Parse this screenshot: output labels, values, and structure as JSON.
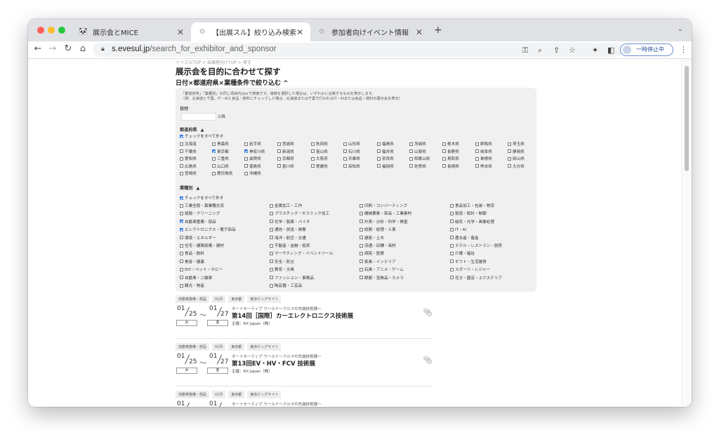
{
  "browser": {
    "tabs": [
      {
        "label": "展示会とMICE",
        "icon": "panda-favicon"
      },
      {
        "label": "【出展スル】絞り込み検索",
        "icon": "gear-favicon"
      },
      {
        "label": "参加者向けイベント情報",
        "icon": "gear-favicon"
      }
    ],
    "new_tab": "+",
    "url_host": "s.evesul.jp",
    "url_path": "/search_for_exhibitor_and_sponsor",
    "profile_label": "一時停止中"
  },
  "page": {
    "breadcrumb": "イベスルTOP > 出展者向けTOP > 探す",
    "title": "展示会を目的に合わせて探す",
    "subtitle": "日付×都道府県×業種条件で絞り込む",
    "subtitle_icon": "^",
    "note1": "「都道府県」「業種別」の同じ項目内はorで検索です。複数を選択した場合は、いずれかに合致するものを表示します。",
    "note2": "（例：北海道と千葉、IT・AIと食品・飲料にチェックした場合…北海道または千葉で行われるIT・AIまたは食品・飲料の展示会を表示）",
    "date_label": "日付",
    "date_suffix": "以降",
    "pref_label": "都道府県",
    "pref_toggle": "▲",
    "pref_uncheck_all": "チェックをすべて外す",
    "industry_label": "業種別",
    "industry_toggle": "▲",
    "industry_uncheck_all": "チェックをすべて外す"
  },
  "prefectures": [
    {
      "name": "北海道",
      "checked": false
    },
    {
      "name": "青森県",
      "checked": false
    },
    {
      "name": "岩手県",
      "checked": false
    },
    {
      "name": "宮城県",
      "checked": false
    },
    {
      "name": "秋田県",
      "checked": false
    },
    {
      "name": "山形県",
      "checked": false
    },
    {
      "name": "福島県",
      "checked": false
    },
    {
      "name": "茨城県",
      "checked": false
    },
    {
      "name": "栃木県",
      "checked": false
    },
    {
      "name": "群馬県",
      "checked": false
    },
    {
      "name": "埼玉県",
      "checked": false
    },
    {
      "name": "千葉県",
      "checked": false
    },
    {
      "name": "東京都",
      "checked": true
    },
    {
      "name": "神奈川県",
      "checked": true
    },
    {
      "name": "新潟県",
      "checked": false
    },
    {
      "name": "富山県",
      "checked": false
    },
    {
      "name": "石川県",
      "checked": false
    },
    {
      "name": "福井県",
      "checked": false
    },
    {
      "name": "山梨県",
      "checked": false
    },
    {
      "name": "長野県",
      "checked": false
    },
    {
      "name": "岐阜県",
      "checked": false
    },
    {
      "name": "静岡県",
      "checked": false
    },
    {
      "name": "愛知県",
      "checked": false
    },
    {
      "name": "三重県",
      "checked": false
    },
    {
      "name": "滋賀県",
      "checked": false
    },
    {
      "name": "京都府",
      "checked": false
    },
    {
      "name": "大阪府",
      "checked": false
    },
    {
      "name": "兵庫県",
      "checked": false
    },
    {
      "name": "奈良県",
      "checked": false
    },
    {
      "name": "和歌山県",
      "checked": false
    },
    {
      "name": "鳥取県",
      "checked": false
    },
    {
      "name": "島根県",
      "checked": false
    },
    {
      "name": "岡山県",
      "checked": false
    },
    {
      "name": "広島県",
      "checked": false
    },
    {
      "name": "山口県",
      "checked": false
    },
    {
      "name": "徳島県",
      "checked": false
    },
    {
      "name": "香川県",
      "checked": false
    },
    {
      "name": "愛媛県",
      "checked": false
    },
    {
      "name": "高知県",
      "checked": false
    },
    {
      "name": "福岡県",
      "checked": false
    },
    {
      "name": "佐賀県",
      "checked": false
    },
    {
      "name": "長崎県",
      "checked": false
    },
    {
      "name": "熊本県",
      "checked": false
    },
    {
      "name": "大分県",
      "checked": false
    },
    {
      "name": "宮崎県",
      "checked": false
    },
    {
      "name": "鹿児島県",
      "checked": false
    },
    {
      "name": "沖縄県",
      "checked": false
    }
  ],
  "industries": [
    {
      "name": "工業全般・異業種交流",
      "checked": false
    },
    {
      "name": "金属加工・工作",
      "checked": false
    },
    {
      "name": "印刷・コンバーティング",
      "checked": false
    },
    {
      "name": "食品加工・包装・物流",
      "checked": false
    },
    {
      "name": "縫製・クリーニング",
      "checked": false
    },
    {
      "name": "プラスチック・セラミック加工",
      "checked": false
    },
    {
      "name": "機械要素・部品・工業素材",
      "checked": false
    },
    {
      "name": "製造・設計・制御",
      "checked": false
    },
    {
      "name": "自動車整備・部品",
      "checked": true
    },
    {
      "name": "化学・製薬・バイオ",
      "checked": false
    },
    {
      "name": "計測・分析・科学・検査",
      "checked": false
    },
    {
      "name": "磁気・光学・画像処理",
      "checked": false
    },
    {
      "name": "エレクトロニクス・電子部品",
      "checked": true
    },
    {
      "name": "通信・放送・映像",
      "checked": false
    },
    {
      "name": "総務・経理・人事",
      "checked": false
    },
    {
      "name": "IT・AI",
      "checked": false
    },
    {
      "name": "環境・エネルギー",
      "checked": false
    },
    {
      "name": "海洋・航空・交通",
      "checked": false
    },
    {
      "name": "建設・土木",
      "checked": false
    },
    {
      "name": "農水産・畜産",
      "checked": false
    },
    {
      "name": "住宅・建築設備・建材",
      "checked": false
    },
    {
      "name": "不動産・金融・投資",
      "checked": false
    },
    {
      "name": "流通・店舗・商材",
      "checked": false
    },
    {
      "name": "ホテル・レストラン・厨房",
      "checked": false
    },
    {
      "name": "食品・飲料",
      "checked": false
    },
    {
      "name": "マーケティング・イベントツール",
      "checked": false
    },
    {
      "name": "病院・医療",
      "checked": false
    },
    {
      "name": "介護・福祉",
      "checked": false
    },
    {
      "name": "美容・健康",
      "checked": false
    },
    {
      "name": "安全・防災",
      "checked": false
    },
    {
      "name": "家具・インテリア",
      "checked": false
    },
    {
      "name": "ギフト・生活雑貨",
      "checked": false
    },
    {
      "name": "DIY・ペット・ホビー",
      "checked": false
    },
    {
      "name": "教育・文具",
      "checked": false
    },
    {
      "name": "玩具・アニメ・ゲーム",
      "checked": false
    },
    {
      "name": "スポーツ・レジャー",
      "checked": false
    },
    {
      "name": "自動車・二輪車",
      "checked": false
    },
    {
      "name": "ファッション・事務品",
      "checked": false
    },
    {
      "name": "眼鏡・宝飾品・カメラ",
      "checked": false
    },
    {
      "name": "花き・園芸・エクステリア",
      "checked": false
    },
    {
      "name": "観光・物産",
      "checked": false
    },
    {
      "name": "陶芸器・工芸品",
      "checked": false
    }
  ],
  "events": [
    {
      "tags": [
        "自動車整備・部品",
        "01月",
        "東京都",
        "東京ビッグサイト"
      ],
      "from_m": "01",
      "from_d": "25",
      "to_m": "01",
      "to_d": "27",
      "from_wd": "水",
      "to_wd": "金",
      "subtitle": "オートモーティブ ワールド～クルマの先端技術展～",
      "title": "第14回［国際］カーエレクトロニクス技術展",
      "organizer": "主催：RX Japan（株）"
    },
    {
      "tags": [
        "自動車整備・部品",
        "01月",
        "東京都",
        "東京ビッグサイト"
      ],
      "from_m": "01",
      "from_d": "25",
      "to_m": "01",
      "to_d": "27",
      "from_wd": "水",
      "to_wd": "金",
      "subtitle": "オートモーティブ ワールド～クルマの先端技術展～",
      "title": "第13回EV・HV・FCV 技術展",
      "organizer": "主催：RX Japan（株）"
    },
    {
      "tags": [
        "自動車整備・部品",
        "01月",
        "東京都",
        "東京ビッグサイト"
      ],
      "from_m": "01",
      "from_d": "",
      "to_m": "01",
      "to_d": "",
      "from_wd": "",
      "to_wd": "",
      "subtitle": "オートモーティブ ワールド～クルマの先端技術展～",
      "title": "",
      "organizer": ""
    }
  ],
  "wave": "～"
}
